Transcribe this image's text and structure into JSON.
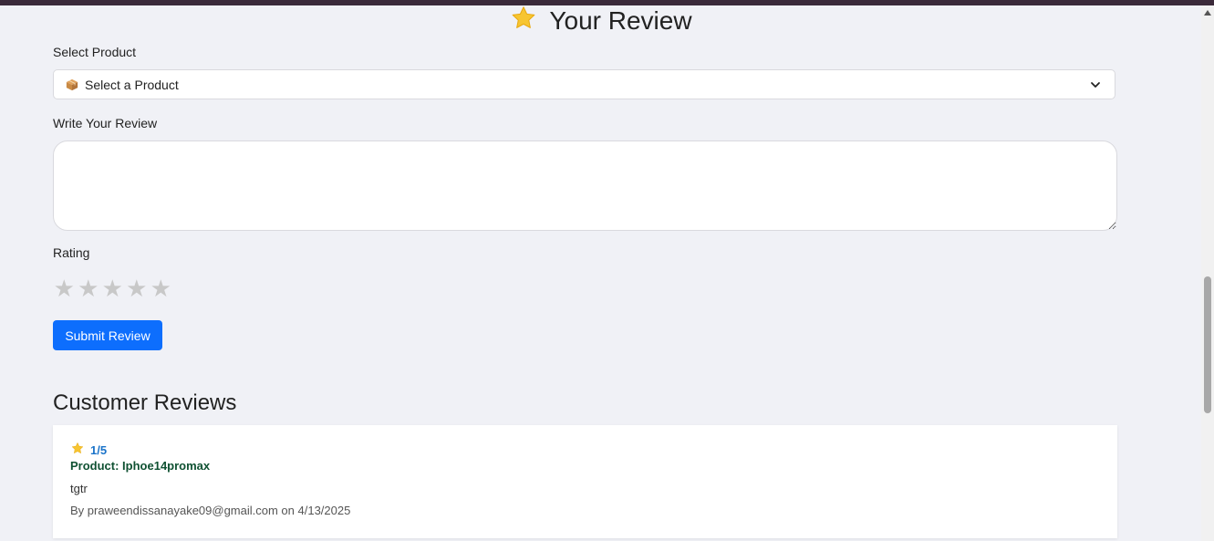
{
  "header": {
    "title": "Your Review",
    "title_icon": "star-emoji-icon"
  },
  "form": {
    "product_label": "Select Product",
    "product_select": {
      "icon": "package-icon",
      "selected_value": "Select a Product"
    },
    "review_label": "Write Your Review",
    "review_value": "",
    "rating_label": "Rating",
    "rating_value": 0,
    "rating_max": 5,
    "star_glyph": "★",
    "submit_label": "Submit Review",
    "submit_color": "#0d6efd"
  },
  "reviews_section": {
    "title": "Customer Reviews",
    "reviews": [
      {
        "rating": "1/5",
        "product": "Product: Iphoe14promax",
        "text": "tgtr",
        "meta": "By praweendissanayake09@gmail.com on 4/13/2025"
      }
    ]
  }
}
